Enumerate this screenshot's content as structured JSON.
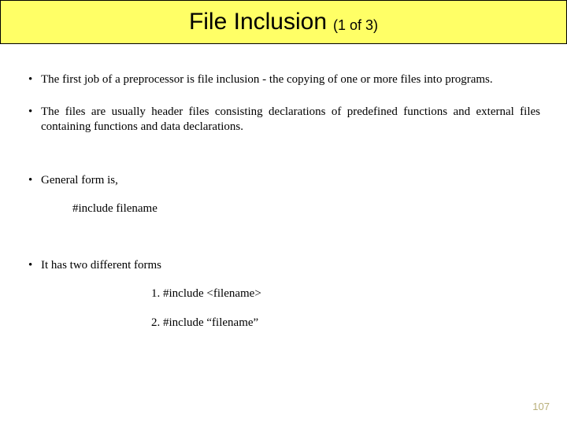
{
  "title": {
    "main": "File Inclusion",
    "sub": "(1 of 3)"
  },
  "bullets": {
    "b1": "The first job of a preprocessor is file inclusion - the copying of one or more files into programs.",
    "b2": "The files are usually header files consisting declarations of predefined functions and external files containing functions and data declarations.",
    "b3": "General form is,",
    "b4": "It has two different forms"
  },
  "lines": {
    "general_form": "#include  filename",
    "form1": "1. #include <filename>",
    "form2": "2. #include “filename”"
  },
  "page_number": "107"
}
